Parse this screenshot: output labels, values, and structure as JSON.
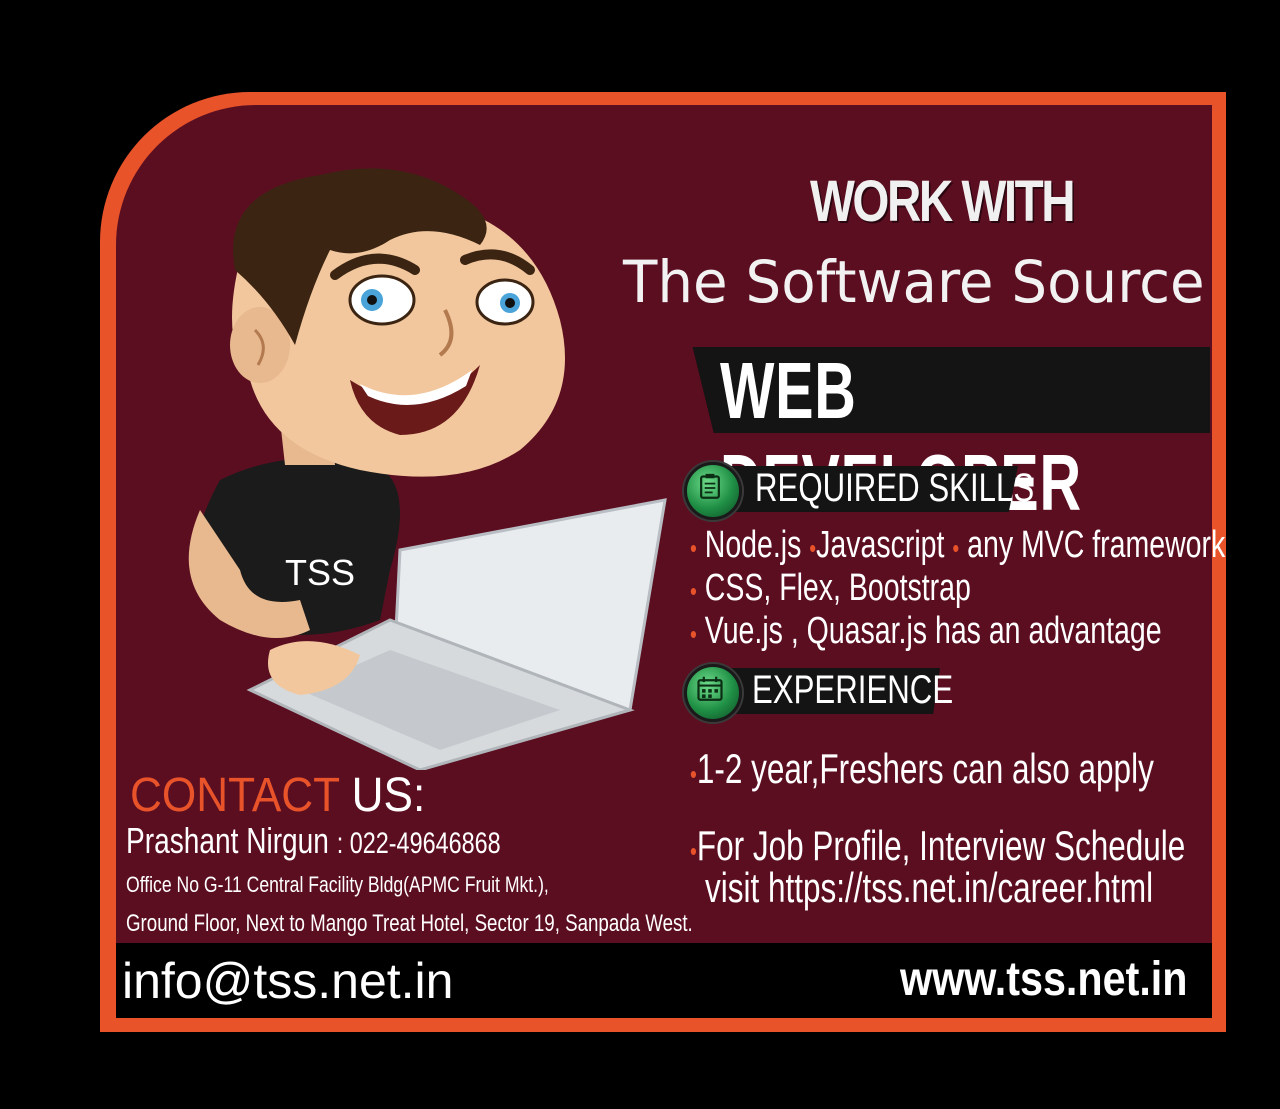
{
  "poster": {
    "work_with": "WORK WITH",
    "company": "The Software Source",
    "job_title": "WEB DEVELOPER",
    "shirt_text": "TSS",
    "colors": {
      "accent": "#e8532a",
      "panel": "#5c0e21",
      "icon": "#1f8f45"
    }
  },
  "skills": {
    "heading": "REQUIRED SKILLS",
    "icon": "clipboard-icon",
    "line1": [
      "Node.js",
      "Javascript",
      "any MVC framework"
    ],
    "line2": "CSS, Flex, Bootstrap",
    "line3": "Vue.js , Quasar.js has an advantage"
  },
  "experience": {
    "heading": "EXPERIENCE",
    "icon": "calendar-icon",
    "detail": "1-2 year,Freshers can also apply",
    "profile_line1": "For Job Profile, Interview Schedule",
    "profile_line2": "visit https://tss.net.in/career.html"
  },
  "contact": {
    "heading_word1": "CONTACT",
    "heading_word2": "US:",
    "person": "Prashant Nirgun",
    "phone": ": 022-49646868",
    "address1": "Office No G-11  Central Facility Bldg(APMC Fruit Mkt.),",
    "address2": "Ground Floor, Next to Mango Treat Hotel, Sector 19, Sanpada West."
  },
  "footer": {
    "email": "info@tss.net.in",
    "website": "www.tss.net.in"
  }
}
